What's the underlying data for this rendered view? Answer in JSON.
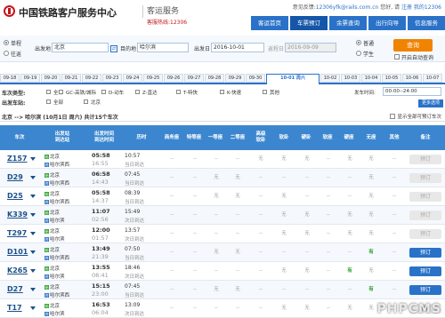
{
  "header": {
    "brand": "中国铁路客户服务中心",
    "sub_brand": "客运服务",
    "hotline": "客服热线:12306",
    "feedback_label": "意见反馈:",
    "feedback_email": "12306yfk@rails.com.cn",
    "user_label": "您好, 请",
    "register": "注册",
    "my_12306": "我的12306",
    "nav": [
      "客运首页",
      "车票预订",
      "余票查询",
      "出行向导",
      "信息服务"
    ],
    "nav_active": 1
  },
  "search": {
    "trip_one": "单程",
    "trip_round": "往返",
    "from_label": "出发地",
    "from_value": "北京",
    "to_label": "目的地",
    "to_value": "哈尔滨",
    "date_label": "出发日",
    "date_value": "2016-10-01",
    "return_label": "返程日",
    "return_value": "2016-09-09",
    "type_normal": "普通",
    "type_student": "学生",
    "query_button": "查询",
    "auto_query": "开启自动查询"
  },
  "dates": [
    "09-18",
    "09-19",
    "09-20",
    "09-21",
    "09-22",
    "09-23",
    "09-24",
    "09-25",
    "09-26",
    "09-27",
    "09-28",
    "09-29",
    "09-30",
    "10-01 周六",
    "10-02",
    "10-03",
    "10-04",
    "10-05",
    "10-06",
    "10-07"
  ],
  "date_active": 13,
  "filters": {
    "type_key": "车次类型:",
    "types": [
      "全部",
      "GC-高铁/城际",
      "D-动车",
      "Z-直达",
      "T-特快",
      "K-快速",
      "其他"
    ],
    "depart_time_key": "发车时间:",
    "depart_time_value": "00:00--24:00",
    "from_key": "出发车站:",
    "from_options": [
      "全部",
      "北京"
    ],
    "to_key": "到达车站:",
    "to_options": [
      "北京南"
    ],
    "more_button": "更多选项"
  },
  "summary": {
    "text": "北京 --> 哈尔滨 (10月1日 周六) 共计15个车次",
    "show_all": "显示全部可预订车次"
  },
  "table": {
    "headers": [
      "车次",
      "出发站\n到达站",
      "出发时间\n到达时间",
      "历时",
      "商务座",
      "特等座",
      "一等座",
      "二等座",
      "高级\n软卧",
      "软卧",
      "硬卧",
      "软座",
      "硬座",
      "无座",
      "其他",
      "备注"
    ],
    "rows": [
      {
        "train": "Z157",
        "from": "北京",
        "to": "哈尔滨西",
        "dep": "05:58",
        "arr": "16:55",
        "dur": "10:57",
        "day": "当日到达",
        "seats": [
          "--",
          "--",
          "--",
          "--",
          "无",
          "无",
          "无",
          "--",
          "无",
          "无",
          "--"
        ],
        "book": "预订",
        "book_on": false
      },
      {
        "train": "D29",
        "from": "北京",
        "to": "哈尔滨西",
        "dep": "06:58",
        "arr": "14:43",
        "dur": "07:45",
        "day": "当日到达",
        "seats": [
          "--",
          "--",
          "无",
          "无",
          "--",
          "--",
          "--",
          "--",
          "--",
          "无",
          "--"
        ],
        "book": "预订",
        "book_on": false
      },
      {
        "train": "D25",
        "from": "北京",
        "to": "哈尔滨西",
        "dep": "05:58",
        "arr": "14:37",
        "dur": "08:39",
        "day": "当日到达",
        "seats": [
          "--",
          "--",
          "无",
          "无",
          "--",
          "无",
          "--",
          "--",
          "--",
          "无",
          "--"
        ],
        "book": "预订",
        "book_on": false
      },
      {
        "train": "K339",
        "from": "北京",
        "to": "哈尔滨",
        "dep": "11:07",
        "arr": "02:56",
        "dur": "15:49",
        "day": "次日到达",
        "seats": [
          "--",
          "--",
          "--",
          "--",
          "--",
          "无",
          "无",
          "--",
          "无",
          "无",
          "--"
        ],
        "book": "预订",
        "book_on": false
      },
      {
        "train": "T297",
        "from": "北京",
        "to": "哈尔滨",
        "dep": "12:00",
        "arr": "01:57",
        "dur": "13:57",
        "day": "次日到达",
        "seats": [
          "--",
          "--",
          "--",
          "--",
          "--",
          "无",
          "无",
          "--",
          "无",
          "无",
          "--"
        ],
        "book": "预订",
        "book_on": false
      },
      {
        "train": "D101",
        "from": "北京",
        "to": "哈尔滨西",
        "dep": "13:49",
        "arr": "21:39",
        "dur": "07:50",
        "day": "当日到达",
        "seats": [
          "--",
          "--",
          "无",
          "无",
          "--",
          "--",
          "--",
          "--",
          "--",
          "有",
          "--"
        ],
        "book": "预订",
        "book_on": true
      },
      {
        "train": "K265",
        "from": "北京",
        "to": "哈尔滨",
        "dep": "13:55",
        "arr": "08:41",
        "dur": "18:46",
        "day": "次日到达",
        "seats": [
          "--",
          "--",
          "--",
          "--",
          "--",
          "无",
          "无",
          "--",
          "有",
          "无",
          "--"
        ],
        "book": "预订",
        "book_on": true
      },
      {
        "train": "D27",
        "from": "北京",
        "to": "哈尔滨西",
        "dep": "15:15",
        "arr": "23:00",
        "dur": "07:45",
        "day": "当日到达",
        "seats": [
          "--",
          "--",
          "无",
          "无",
          "--",
          "--",
          "--",
          "--",
          "--",
          "有",
          "--"
        ],
        "book": "预订",
        "book_on": true
      },
      {
        "train": "T17",
        "from": "北京",
        "to": "哈尔滨",
        "dep": "16:53",
        "arr": "06:04",
        "dur": "13:09",
        "day": "次日到达",
        "seats": [
          "--",
          "--",
          "--",
          "--",
          "--",
          "无",
          "无",
          "--",
          "无",
          "无",
          "--"
        ],
        "book": "预订",
        "book_on": false
      }
    ]
  },
  "watermark": "PHPCMS",
  "colors": {
    "accent": "#2a72c8",
    "header_bg": "#3b86cf",
    "query": "#f08300",
    "brand_red": "#c4161c",
    "available": "#2ca02c"
  }
}
